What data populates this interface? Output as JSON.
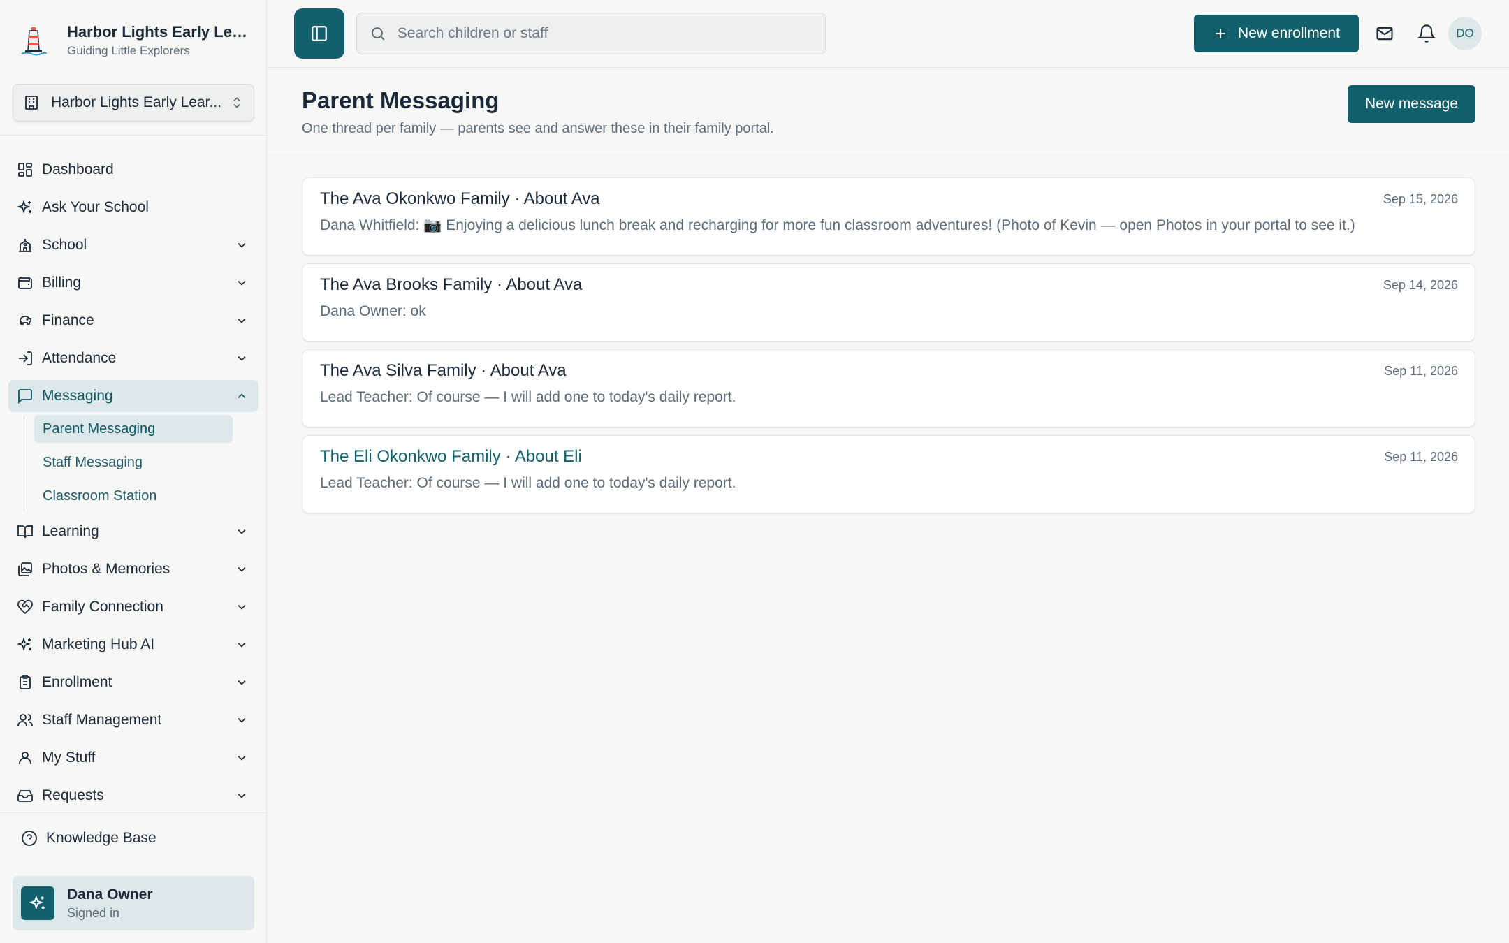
{
  "brand": {
    "title": "Harbor Lights Early Learn...",
    "subtitle": "Guiding Little Explorers"
  },
  "school_selector": {
    "label": "Harbor Lights Early Lear..."
  },
  "nav": {
    "dashboard": "Dashboard",
    "ask": "Ask Your School",
    "school": "School",
    "billing": "Billing",
    "finance": "Finance",
    "attendance": "Attendance",
    "messaging": "Messaging",
    "messaging_sub": {
      "parent": "Parent Messaging",
      "staff": "Staff Messaging",
      "classroom": "Classroom Station"
    },
    "learning": "Learning",
    "photos": "Photos & Memories",
    "family": "Family Connection",
    "marketing": "Marketing Hub AI",
    "enrollment": "Enrollment",
    "staff": "Staff Management",
    "mystuff": "My Stuff",
    "requests": "Requests"
  },
  "footer": {
    "knowledge_base": "Knowledge Base",
    "user_name": "Dana Owner",
    "user_status": "Signed in"
  },
  "topbar": {
    "search_placeholder": "Search children or staff",
    "new_enrollment": "New enrollment",
    "avatar_initials": "DO"
  },
  "page": {
    "title": "Parent Messaging",
    "subtitle": "One thread per family — parents see and answer these in their family portal.",
    "new_message": "New message"
  },
  "threads": [
    {
      "title": "The Ava Okonkwo Family · About Ava",
      "date": "Sep 15, 2026",
      "preview": "Dana Whitfield: 📷 Enjoying a delicious lunch break and recharging for more fun classroom adventures! (Photo of Kevin — open Photos in your portal to see it.)"
    },
    {
      "title": "The Ava Brooks Family · About Ava",
      "date": "Sep 14, 2026",
      "preview": "Dana Owner: ok"
    },
    {
      "title": "The Ava Silva Family · About Ava",
      "date": "Sep 11, 2026",
      "preview": "Lead Teacher: Of course — I will add one to today's daily report."
    },
    {
      "title": "The Eli Okonkwo Family · About Eli",
      "date": "Sep 11, 2026",
      "preview": "Lead Teacher: Of course — I will add one to today's daily report."
    }
  ],
  "colors": {
    "accent": "#11606c",
    "active_bg": "#dde8ea",
    "background": "#f7f7f5"
  }
}
